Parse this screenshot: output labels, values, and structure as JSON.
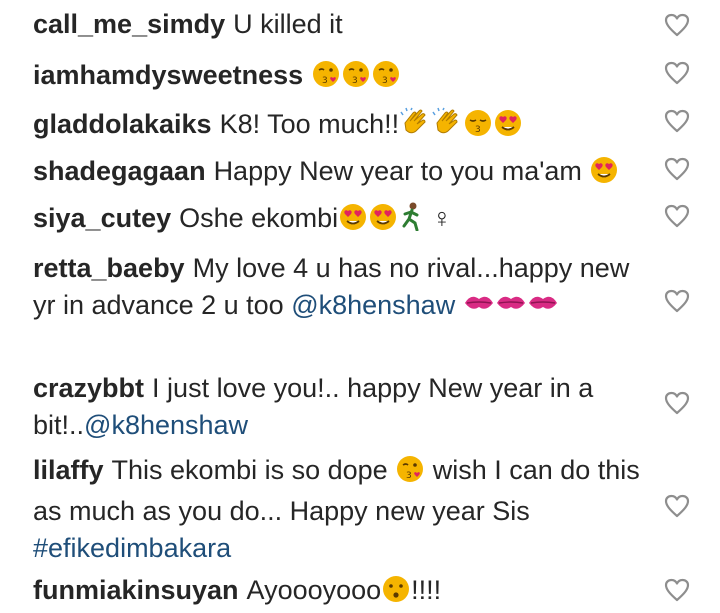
{
  "comments": [
    {
      "user": "call_me_simdy",
      "text": "U killed it",
      "emojis": []
    },
    {
      "user": "iamhamdysweetness",
      "text": "",
      "emojis": [
        "kiss-face",
        "kiss-face",
        "kiss-face"
      ]
    },
    {
      "user": "gladdolakaiks",
      "text": "K8! Too much!!",
      "emojis": [
        "clap",
        "clap",
        "kiss-face-closed",
        "heart-eyes"
      ]
    },
    {
      "user": "shadegagaan",
      "text": "Happy New year to you ma'am",
      "emojis": [
        "heart-eyes"
      ]
    },
    {
      "user": "siya_cutey",
      "text": "Oshe ekombi",
      "emojis": [
        "heart-eyes",
        "heart-eyes",
        "runner"
      ],
      "suffix": "♀"
    },
    {
      "user": "retta_baeby",
      "text": "My love 4 u has no rival...happy new yr in advance 2 u too",
      "mention": "@k8henshaw",
      "emojis": [
        "kiss-mark",
        "kiss-mark",
        "kiss-mark"
      ]
    },
    {
      "user": "crazybbt",
      "text": "I just love you!.. happy New year in a bit!..",
      "mention": "@k8henshaw",
      "emojis": []
    },
    {
      "user": "lilaffy",
      "text": "This ekombi is so dope",
      "emojis": [
        "kiss-face"
      ],
      "text2": "wish I can do this as much as you do... Happy new year Sis",
      "hashtag": "#efikedimbakara"
    },
    {
      "user": "funmiakinsuyan",
      "text": "Ayoooyooo",
      "emojis": [
        "hushed"
      ],
      "suffix": "!!!!"
    }
  ],
  "icons": {
    "like": "heart-outline-icon"
  },
  "colors": {
    "text": "#262626",
    "link": "#1f4e79",
    "emoji": "#f5b400"
  }
}
